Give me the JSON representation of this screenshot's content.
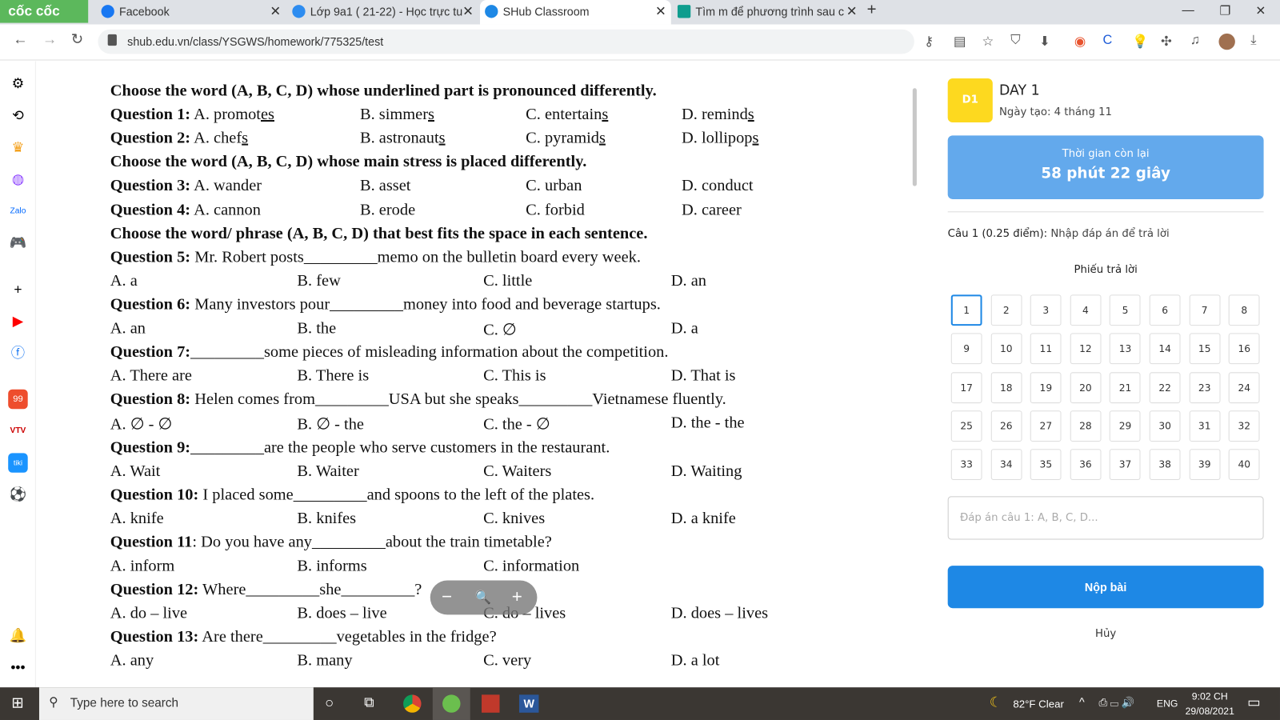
{
  "browser": {
    "brand": "cốc cốc",
    "tabs": [
      {
        "title": "Facebook",
        "color": "#1877f2"
      },
      {
        "title": "Lớp 9a1 ( 21-22) - Học trực tu",
        "color": "#2d8cf0"
      },
      {
        "title": "SHub Classroom",
        "color": "#1e88e5"
      },
      {
        "title": "Tìm m để phương trình sau c",
        "color": "#0f9d8e"
      }
    ],
    "close": "✕",
    "new_tab": "+",
    "url": "shub.edu.vn/class/YSGWS/homework/775325/test"
  },
  "document": {
    "lines": [
      {
        "t": "h",
        "text": "Choose the word (A, B, C, D) whose underlined part is pronounced differently."
      },
      {
        "t": "q",
        "label": "Question 1:",
        "text": " A. ",
        "opts": [
          [
            "promot",
            "es"
          ],
          [
            "B. simmer",
            "s"
          ],
          [
            "C. entertain",
            "s"
          ],
          [
            "D. remind",
            "s"
          ]
        ],
        "cols": "a"
      },
      {
        "t": "q",
        "label": "Question 2:",
        "text": " A. ",
        "opts": [
          [
            "chef",
            "s"
          ],
          [
            "B. astronaut",
            "s"
          ],
          [
            "C. pyramid",
            "s"
          ],
          [
            "D. lollipop",
            "s"
          ]
        ],
        "cols": "a"
      },
      {
        "t": "h",
        "text": "Choose the word (A, B, C, D) whose main stress is placed differently."
      },
      {
        "t": "q",
        "label": "Question 3:",
        "text": " A. ",
        "opts": [
          [
            "wander",
            ""
          ],
          [
            "B. asset",
            ""
          ],
          [
            "C. urban",
            ""
          ],
          [
            "D. conduct",
            ""
          ]
        ],
        "cols": "a"
      },
      {
        "t": "q",
        "label": "Question 4:",
        "text": " A. ",
        "opts": [
          [
            "cannon",
            ""
          ],
          [
            "B. erode",
            ""
          ],
          [
            "C. forbid",
            ""
          ],
          [
            "D. career",
            ""
          ]
        ],
        "cols": "a"
      },
      {
        "t": "h",
        "text": "Choose the word/ phrase (A, B, C, D) that best fits the space in each sentence."
      },
      {
        "t": "s",
        "label": "Question 5:",
        "text": " Mr. Robert posts_________memo on the bulletin board every week."
      },
      {
        "t": "o",
        "opts": [
          "A. a",
          "B. few",
          "C. little",
          "D. an"
        ]
      },
      {
        "t": "s",
        "label": "Question 6:",
        "text": " Many investors pour_________money into food and beverage startups."
      },
      {
        "t": "o",
        "opts": [
          "A. an",
          "B. the",
          "C. ∅",
          "D. a"
        ]
      },
      {
        "t": "s",
        "label": "Question 7:",
        "text": "_________some pieces of misleading information about the competition."
      },
      {
        "t": "o",
        "opts": [
          "A. There are",
          "B. There is",
          "C. This is",
          "D. That is"
        ]
      },
      {
        "t": "s",
        "label": "Question 8:",
        "text": " Helen comes from_________USA but she speaks_________Vietnamese fluently."
      },
      {
        "t": "o",
        "opts": [
          "A. ∅ - ∅",
          "B. ∅ - the",
          "C. the - ∅",
          "D. the - the"
        ]
      },
      {
        "t": "s",
        "label": "Question 9:",
        "text": "_________are the people who serve customers in the restaurant."
      },
      {
        "t": "o",
        "opts": [
          "A. Wait",
          "B. Waiter",
          "C. Waiters",
          "D. Waiting"
        ]
      },
      {
        "t": "s",
        "label": "Question 10:",
        "text": " I placed some_________and spoons to the left of the plates."
      },
      {
        "t": "o",
        "opts": [
          "A. knife",
          "B. knifes",
          "C. knives",
          "D. a knife"
        ]
      },
      {
        "t": "s",
        "label": "Question 11",
        "text": ": Do you have any_________about the train timetable?"
      },
      {
        "t": "o",
        "opts": [
          "A. inform",
          "B. informs",
          "C. information"
        ]
      },
      {
        "t": "s",
        "label": "Question 12:",
        "text": " Where_________she_________?"
      },
      {
        "t": "o",
        "opts": [
          "A. do – live",
          "B. does – live",
          "C. do – lives",
          "D. does – lives"
        ]
      },
      {
        "t": "s",
        "label": "Question 13:",
        "text": " Are there_________vegetables in the fridge?"
      },
      {
        "t": "o",
        "opts": [
          "A. any",
          "B. many",
          "C. very",
          "D. a lot"
        ]
      }
    ]
  },
  "zoom": {
    "minus": "−",
    "icon": "🔍",
    "plus": "+"
  },
  "panel": {
    "badge": "D1",
    "title": "DAY 1",
    "created": "Ngày tạo: 4 tháng 11",
    "timer_label": "Thời gian còn lại",
    "timer_value": "58 phút 22 giây",
    "question_label": "Câu 1 (0.25 điểm):",
    "question_hint": " Nhập đáp án để trả lời",
    "sheet_title": "Phiếu trả lời",
    "total_questions": 40,
    "selected": 1,
    "answer_placeholder": "Đáp án câu 1: A, B, C, D...",
    "submit": "Nộp bài",
    "cancel": "Hủy",
    "accent": "#1e88e5"
  },
  "taskbar": {
    "search_placeholder": "Type here to search",
    "weather": "82°F  Clear",
    "lang": "ENG",
    "time": "9:02 CH",
    "date": "29/08/2021"
  }
}
